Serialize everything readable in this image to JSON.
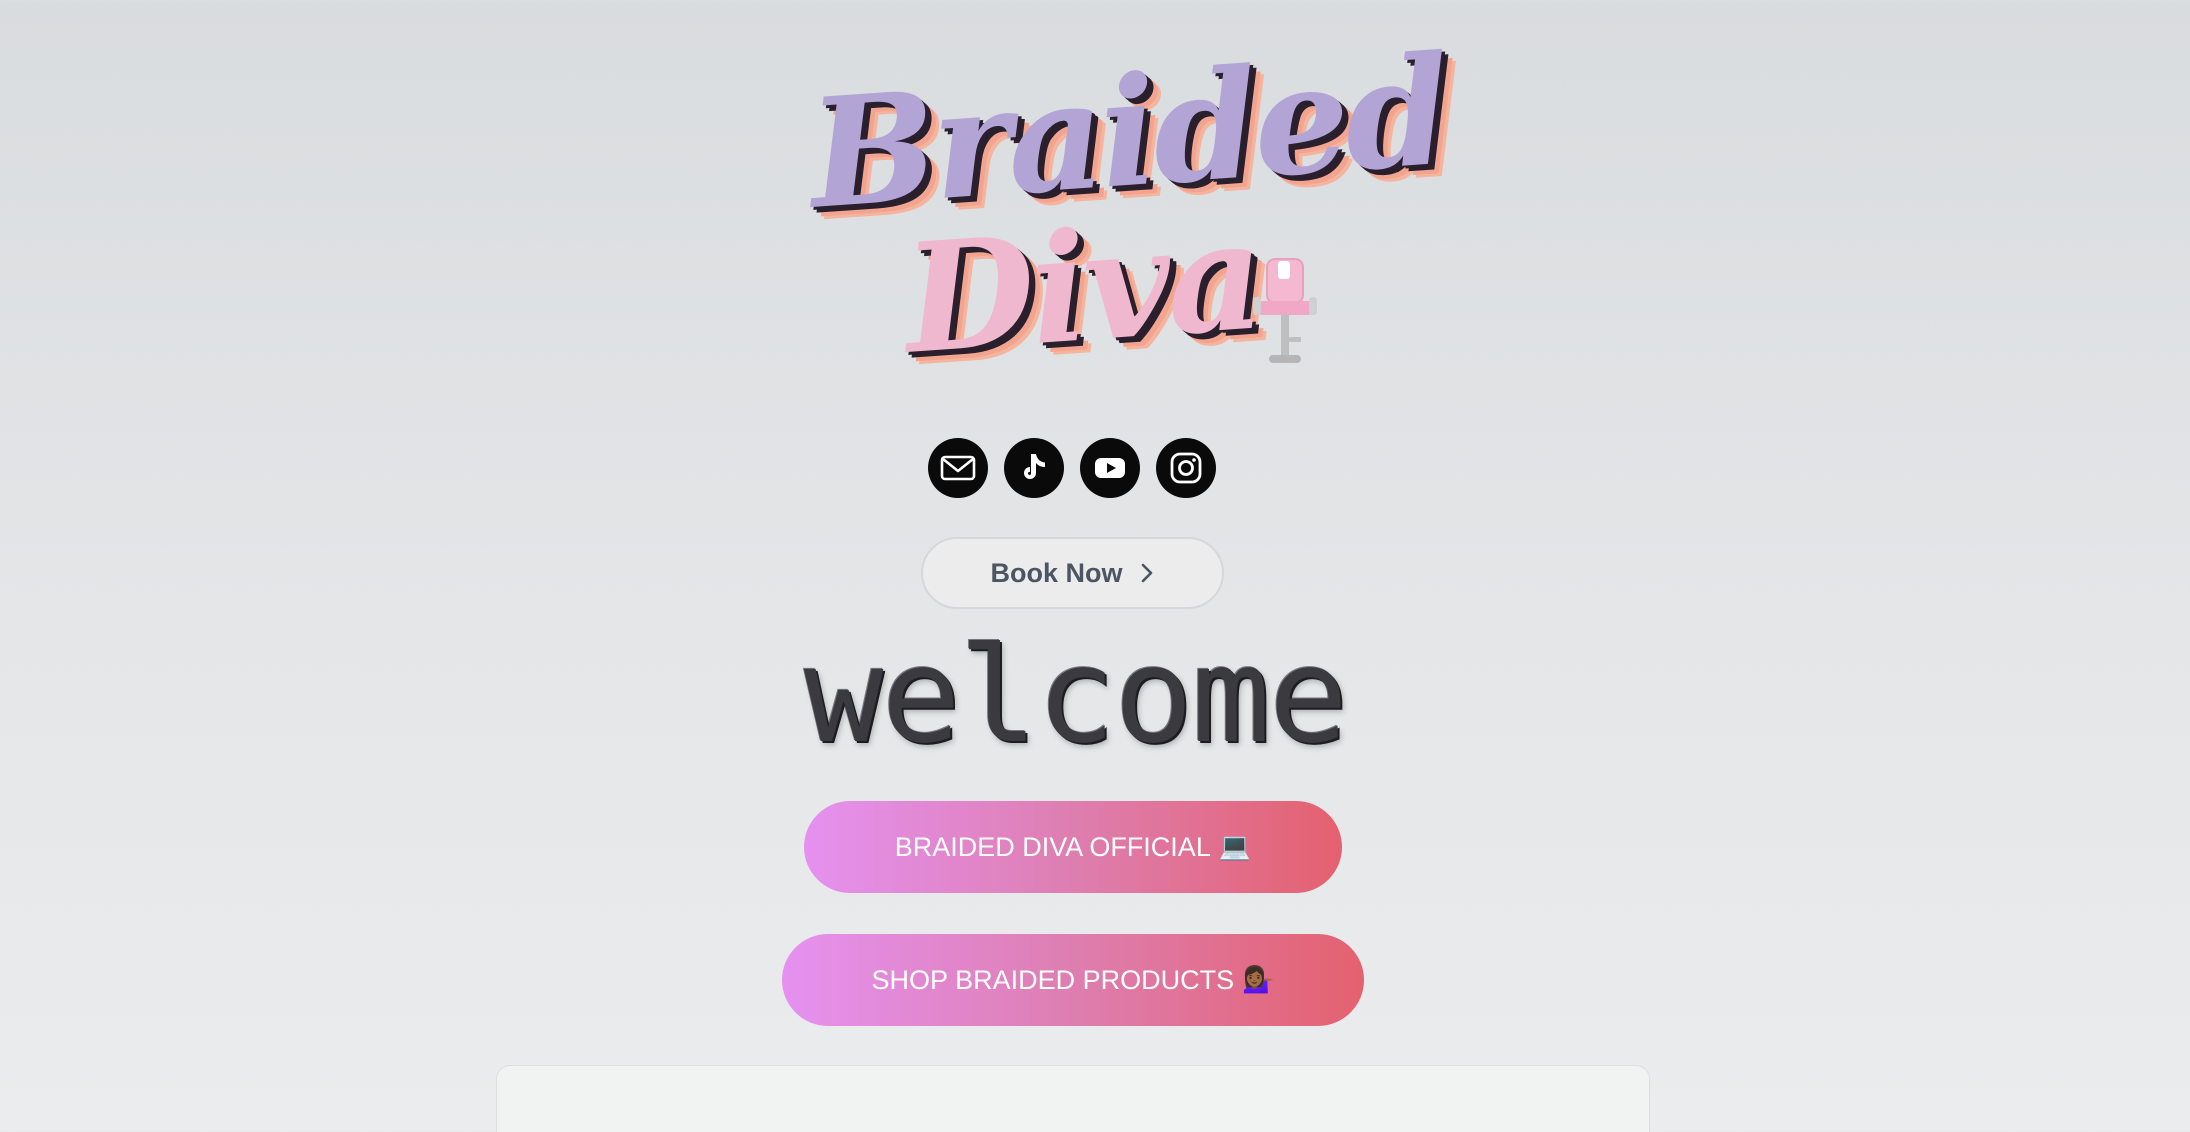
{
  "logo": {
    "line1": "Braided",
    "line2": "Diva",
    "chair_icon": "salon-chair-icon"
  },
  "socials": [
    {
      "name": "email",
      "icon": "email-icon"
    },
    {
      "name": "tiktok",
      "icon": "tiktok-icon"
    },
    {
      "name": "youtube",
      "icon": "youtube-icon"
    },
    {
      "name": "instagram",
      "icon": "instagram-icon"
    }
  ],
  "book": {
    "label": "Book Now",
    "icon": "chevron-right-icon"
  },
  "welcome": {
    "text": "welcome"
  },
  "links": [
    {
      "label": "BRAIDED DIVA OFFICIAL",
      "emoji": "💻"
    },
    {
      "label": "SHOP BRAIDED PRODUCTS",
      "emoji": "💁🏾‍♀️"
    }
  ],
  "colors": {
    "background": "#dfe1e3",
    "button_gradient_start": "#e591f0",
    "button_gradient_end": "#e4616f",
    "social_icon_bg": "#0a0a0a",
    "logo_purple": "#b3a4d6",
    "logo_pink": "#f0b8cf"
  }
}
